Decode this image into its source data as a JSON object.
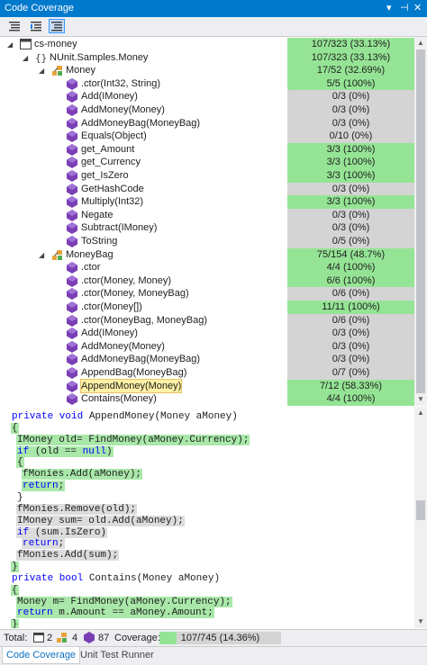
{
  "window": {
    "title": "Code Coverage",
    "dropdown_glyph": "▾",
    "pin_glyph": "⊣",
    "close_glyph": "✕"
  },
  "colors": {
    "accent": "#007acc",
    "covered": "#95e495",
    "uncovered": "#d4d4d4",
    "selected": "#fff1a6"
  },
  "tree": [
    {
      "level": 0,
      "expander": "◢",
      "icon": "solution-icon",
      "label": "cs-money",
      "coverage": "107/323 (33.13%)",
      "status": "green"
    },
    {
      "level": 1,
      "expander": "◢",
      "icon": "namespace-icon",
      "label": "NUnit.Samples.Money",
      "coverage": "107/323 (33.13%)",
      "status": "green"
    },
    {
      "level": 2,
      "expander": "◢",
      "icon": "class-icon",
      "label": "Money",
      "coverage": "17/52 (32.69%)",
      "status": "green"
    },
    {
      "level": 3,
      "icon": "method-icon",
      "label": ".ctor(Int32, String)",
      "coverage": "5/5 (100%)",
      "status": "green"
    },
    {
      "level": 3,
      "icon": "method-icon",
      "label": "Add(IMoney)",
      "coverage": "0/3 (0%)",
      "status": "gray"
    },
    {
      "level": 3,
      "icon": "method-icon",
      "label": "AddMoney(Money)",
      "coverage": "0/3 (0%)",
      "status": "gray"
    },
    {
      "level": 3,
      "icon": "method-icon",
      "label": "AddMoneyBag(MoneyBag)",
      "coverage": "0/3 (0%)",
      "status": "gray"
    },
    {
      "level": 3,
      "icon": "method-icon",
      "label": "Equals(Object)",
      "coverage": "0/10 (0%)",
      "status": "gray"
    },
    {
      "level": 3,
      "icon": "method-icon",
      "label": "get_Amount",
      "coverage": "3/3 (100%)",
      "status": "green"
    },
    {
      "level": 3,
      "icon": "method-icon",
      "label": "get_Currency",
      "coverage": "3/3 (100%)",
      "status": "green"
    },
    {
      "level": 3,
      "icon": "method-icon",
      "label": "get_IsZero",
      "coverage": "3/3 (100%)",
      "status": "green"
    },
    {
      "level": 3,
      "icon": "method-icon",
      "label": "GetHashCode",
      "coverage": "0/3 (0%)",
      "status": "gray"
    },
    {
      "level": 3,
      "icon": "method-icon",
      "label": "Multiply(Int32)",
      "coverage": "3/3 (100%)",
      "status": "green"
    },
    {
      "level": 3,
      "icon": "method-icon",
      "label": "Negate",
      "coverage": "0/3 (0%)",
      "status": "gray"
    },
    {
      "level": 3,
      "icon": "method-icon",
      "label": "Subtract(IMoney)",
      "coverage": "0/3 (0%)",
      "status": "gray"
    },
    {
      "level": 3,
      "icon": "method-icon",
      "label": "ToString",
      "coverage": "0/5 (0%)",
      "status": "gray"
    },
    {
      "level": 2,
      "expander": "◢",
      "icon": "class-icon",
      "label": "MoneyBag",
      "coverage": "75/154 (48.7%)",
      "status": "green"
    },
    {
      "level": 3,
      "icon": "method-icon",
      "label": ".ctor",
      "coverage": "4/4 (100%)",
      "status": "green"
    },
    {
      "level": 3,
      "icon": "method-icon",
      "label": ".ctor(Money, Money)",
      "coverage": "6/6 (100%)",
      "status": "green"
    },
    {
      "level": 3,
      "icon": "method-icon",
      "label": ".ctor(Money, MoneyBag)",
      "coverage": "0/6 (0%)",
      "status": "gray"
    },
    {
      "level": 3,
      "icon": "method-icon",
      "label": ".ctor(Money[])",
      "coverage": "11/11 (100%)",
      "status": "green"
    },
    {
      "level": 3,
      "icon": "method-icon",
      "label": ".ctor(MoneyBag, MoneyBag)",
      "coverage": "0/6 (0%)",
      "status": "gray"
    },
    {
      "level": 3,
      "icon": "method-icon",
      "label": "Add(IMoney)",
      "coverage": "0/3 (0%)",
      "status": "gray"
    },
    {
      "level": 3,
      "icon": "method-icon",
      "label": "AddMoney(Money)",
      "coverage": "0/3 (0%)",
      "status": "gray"
    },
    {
      "level": 3,
      "icon": "method-icon",
      "label": "AddMoneyBag(MoneyBag)",
      "coverage": "0/3 (0%)",
      "status": "gray"
    },
    {
      "level": 3,
      "icon": "method-icon",
      "label": "AppendBag(MoneyBag)",
      "coverage": "0/7 (0%)",
      "status": "gray"
    },
    {
      "level": 3,
      "icon": "method-icon",
      "label": "AppendMoney(Money)",
      "coverage": "7/12 (58.33%)",
      "status": "green",
      "selected": true
    },
    {
      "level": 3,
      "icon": "method-icon",
      "label": "Contains(Money)",
      "coverage": "4/4 (100%)",
      "status": "green"
    }
  ],
  "code": [
    {
      "indent": 1,
      "segments": [
        {
          "t": "private void ",
          "kw": true
        },
        {
          "t": "AppendMoney(Money aMoney)"
        }
      ],
      "hl": "none"
    },
    {
      "indent": 1,
      "segments": [
        {
          "t": "{"
        }
      ],
      "hl": "green"
    },
    {
      "indent": 2,
      "segments": [
        {
          "t": "IMoney old= FindMoney(aMoney.Currency);"
        }
      ],
      "hl": "green"
    },
    {
      "indent": 2,
      "segments": [
        {
          "t": "if ",
          "kw": true
        },
        {
          "t": "(old == "
        },
        {
          "t": "null",
          "kw": true
        },
        {
          "t": ")"
        }
      ],
      "hl": "green"
    },
    {
      "indent": 2,
      "segments": [
        {
          "t": "{"
        }
      ],
      "hl": "green"
    },
    {
      "indent": 3,
      "segments": [
        {
          "t": "fMonies.Add(aMoney);"
        }
      ],
      "hl": "green"
    },
    {
      "indent": 3,
      "segments": [
        {
          "t": "return",
          "kw": true
        },
        {
          "t": ";"
        }
      ],
      "hl": "green"
    },
    {
      "indent": 2,
      "segments": [
        {
          "t": "}"
        }
      ],
      "hl": "none"
    },
    {
      "indent": 2,
      "segments": [
        {
          "t": "fMonies.Remove(old);"
        }
      ],
      "hl": "gray"
    },
    {
      "indent": 2,
      "segments": [
        {
          "t": "IMoney sum= old.Add(aMoney);"
        }
      ],
      "hl": "gray"
    },
    {
      "indent": 2,
      "segments": [
        {
          "t": "if ",
          "kw": true
        },
        {
          "t": "(sum.IsZero)"
        }
      ],
      "hl": "gray"
    },
    {
      "indent": 3,
      "segments": [
        {
          "t": "return",
          "kw": true
        },
        {
          "t": ";"
        }
      ],
      "hl": "gray"
    },
    {
      "indent": 2,
      "segments": [
        {
          "t": "fMonies.Add(sum);"
        }
      ],
      "hl": "gray"
    },
    {
      "indent": 1,
      "segments": [
        {
          "t": "}"
        }
      ],
      "hl": "green"
    },
    {
      "indent": 1,
      "segments": [
        {
          "t": "private bool ",
          "kw": true
        },
        {
          "t": "Contains(Money aMoney)"
        }
      ],
      "hl": "none"
    },
    {
      "indent": 1,
      "segments": [
        {
          "t": "{"
        }
      ],
      "hl": "green"
    },
    {
      "indent": 2,
      "segments": [
        {
          "t": "Money m= FindMoney(aMoney.Currency);"
        }
      ],
      "hl": "green"
    },
    {
      "indent": 2,
      "segments": [
        {
          "t": "return ",
          "kw": true
        },
        {
          "t": "m.Amount == aMoney.Amount;"
        }
      ],
      "hl": "green"
    },
    {
      "indent": 1,
      "segments": [
        {
          "t": "}"
        }
      ],
      "hl": "green"
    }
  ],
  "total": {
    "label": "Total:",
    "files": "2",
    "classes": "4",
    "methods": "87",
    "coverage_label": "Coverage:",
    "coverage": "107/745 (14.36%)",
    "coverage_fraction": 0.1436
  },
  "tabs": [
    "Code Coverage",
    "Unit Test Runner"
  ]
}
